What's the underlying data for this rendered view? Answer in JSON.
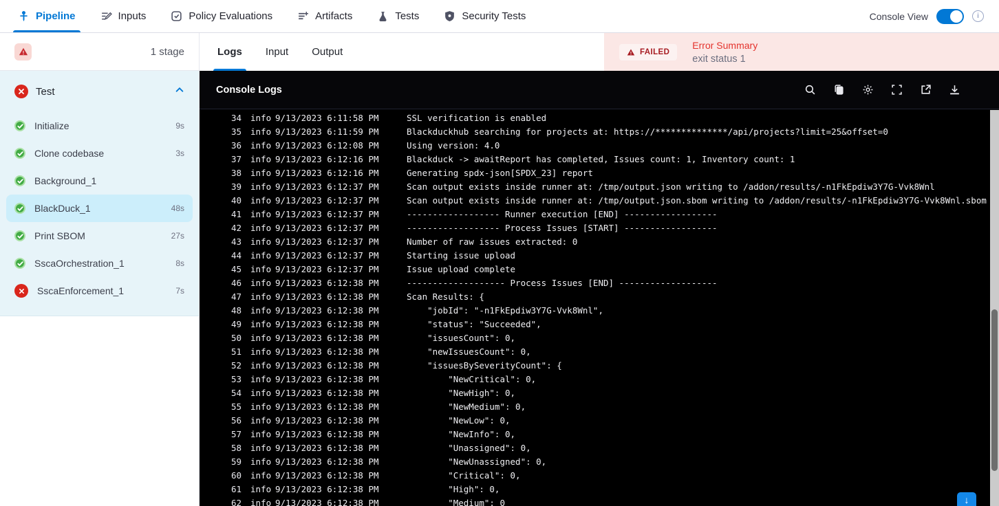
{
  "nav": {
    "tabs": [
      {
        "label": "Pipeline",
        "icon": "pipeline-icon",
        "active": true
      },
      {
        "label": "Inputs",
        "icon": "inputs-icon",
        "active": false
      },
      {
        "label": "Policy Evaluations",
        "icon": "policy-check-icon",
        "active": false
      },
      {
        "label": "Artifacts",
        "icon": "list-plus-icon",
        "active": false
      },
      {
        "label": "Tests",
        "icon": "flask-icon",
        "active": false
      },
      {
        "label": "Security Tests",
        "icon": "shield-icon",
        "active": false
      }
    ],
    "console_view_label": "Console View",
    "console_view_toggle": "on"
  },
  "sidebar": {
    "stage_count": "1 stage",
    "stage": {
      "name": "Test",
      "status": "failed"
    },
    "steps": [
      {
        "name": "Initialize",
        "duration": "9s",
        "status": "success",
        "selected": false
      },
      {
        "name": "Clone codebase",
        "duration": "3s",
        "status": "success",
        "selected": false
      },
      {
        "name": "Background_1",
        "duration": "",
        "status": "success",
        "selected": false
      },
      {
        "name": "BlackDuck_1",
        "duration": "48s",
        "status": "success",
        "selected": true
      },
      {
        "name": "Print SBOM",
        "duration": "27s",
        "status": "success",
        "selected": false
      },
      {
        "name": "SscaOrchestration_1",
        "duration": "8s",
        "status": "success",
        "selected": false
      },
      {
        "name": "SscaEnforcement_1",
        "duration": "7s",
        "status": "failed",
        "selected": false
      }
    ]
  },
  "main": {
    "tabs": [
      "Logs",
      "Input",
      "Output"
    ],
    "active_tab": "Logs",
    "error_summary": {
      "badge": "FAILED",
      "title": "Error Summary",
      "message": "exit status 1"
    }
  },
  "console": {
    "title": "Console Logs",
    "toolbar_icons": [
      "search-icon",
      "copy-icon",
      "settings-icon",
      "fullscreen-icon",
      "open-in-new-icon",
      "download-icon"
    ],
    "logs": [
      {
        "n": 34,
        "level": "info",
        "time": "9/13/2023 6:11:58 PM",
        "msg": "SSL verification is enabled"
      },
      {
        "n": 35,
        "level": "info",
        "time": "9/13/2023 6:11:59 PM",
        "msg": "Blackduckhub searching for projects at: https://**************/api/projects?limit=25&offset=0"
      },
      {
        "n": 36,
        "level": "info",
        "time": "9/13/2023 6:12:08 PM",
        "msg": "Using version: 4.0"
      },
      {
        "n": 37,
        "level": "info",
        "time": "9/13/2023 6:12:16 PM",
        "msg": "Blackduck -> awaitReport has completed, Issues count: 1, Inventory count: 1"
      },
      {
        "n": 38,
        "level": "info",
        "time": "9/13/2023 6:12:16 PM",
        "msg": "Generating spdx-json[SPDX_23] report"
      },
      {
        "n": 39,
        "level": "info",
        "time": "9/13/2023 6:12:37 PM",
        "msg": "Scan output exists inside runner at: /tmp/output.json writing to /addon/results/-n1FkEpdiw3Y7G-Vvk8Wnl"
      },
      {
        "n": 40,
        "level": "info",
        "time": "9/13/2023 6:12:37 PM",
        "msg": "Scan output exists inside runner at: /tmp/output.json.sbom writing to /addon/results/-n1FkEpdiw3Y7G-Vvk8Wnl.sbom"
      },
      {
        "n": 41,
        "level": "info",
        "time": "9/13/2023 6:12:37 PM",
        "msg": "------------------ Runner execution [END] ------------------"
      },
      {
        "n": 42,
        "level": "info",
        "time": "9/13/2023 6:12:37 PM",
        "msg": "------------------ Process Issues [START] ------------------"
      },
      {
        "n": 43,
        "level": "info",
        "time": "9/13/2023 6:12:37 PM",
        "msg": "Number of raw issues extracted: 0"
      },
      {
        "n": 44,
        "level": "info",
        "time": "9/13/2023 6:12:37 PM",
        "msg": "Starting issue upload"
      },
      {
        "n": 45,
        "level": "info",
        "time": "9/13/2023 6:12:37 PM",
        "msg": "Issue upload complete"
      },
      {
        "n": 46,
        "level": "info",
        "time": "9/13/2023 6:12:38 PM",
        "msg": "------------------- Process Issues [END] -------------------"
      },
      {
        "n": 47,
        "level": "info",
        "time": "9/13/2023 6:12:38 PM",
        "msg": "Scan Results: {"
      },
      {
        "n": 48,
        "level": "info",
        "time": "9/13/2023 6:12:38 PM",
        "msg": "    \"jobId\": \"-n1FkEpdiw3Y7G-Vvk8Wnl\","
      },
      {
        "n": 49,
        "level": "info",
        "time": "9/13/2023 6:12:38 PM",
        "msg": "    \"status\": \"Succeeded\","
      },
      {
        "n": 50,
        "level": "info",
        "time": "9/13/2023 6:12:38 PM",
        "msg": "    \"issuesCount\": 0,"
      },
      {
        "n": 51,
        "level": "info",
        "time": "9/13/2023 6:12:38 PM",
        "msg": "    \"newIssuesCount\": 0,"
      },
      {
        "n": 52,
        "level": "info",
        "time": "9/13/2023 6:12:38 PM",
        "msg": "    \"issuesBySeverityCount\": {"
      },
      {
        "n": 53,
        "level": "info",
        "time": "9/13/2023 6:12:38 PM",
        "msg": "        \"NewCritical\": 0,"
      },
      {
        "n": 54,
        "level": "info",
        "time": "9/13/2023 6:12:38 PM",
        "msg": "        \"NewHigh\": 0,"
      },
      {
        "n": 55,
        "level": "info",
        "time": "9/13/2023 6:12:38 PM",
        "msg": "        \"NewMedium\": 0,"
      },
      {
        "n": 56,
        "level": "info",
        "time": "9/13/2023 6:12:38 PM",
        "msg": "        \"NewLow\": 0,"
      },
      {
        "n": 57,
        "level": "info",
        "time": "9/13/2023 6:12:38 PM",
        "msg": "        \"NewInfo\": 0,"
      },
      {
        "n": 58,
        "level": "info",
        "time": "9/13/2023 6:12:38 PM",
        "msg": "        \"Unassigned\": 0,"
      },
      {
        "n": 59,
        "level": "info",
        "time": "9/13/2023 6:12:38 PM",
        "msg": "        \"NewUnassigned\": 0,"
      },
      {
        "n": 60,
        "level": "info",
        "time": "9/13/2023 6:12:38 PM",
        "msg": "        \"Critical\": 0,"
      },
      {
        "n": 61,
        "level": "info",
        "time": "9/13/2023 6:12:38 PM",
        "msg": "        \"High\": 0,"
      },
      {
        "n": 62,
        "level": "info",
        "time": "9/13/2023 6:12:38 PM",
        "msg": "        \"Medium\": 0"
      }
    ]
  },
  "colors": {
    "accent_blue": "#0278d5",
    "sidebar_blue": "#e7f4f9",
    "selected_step": "#cceefb",
    "success_green": "#42ab45",
    "fail_red": "#d9261c",
    "error_panel_pink": "#fbe7e5",
    "error_text_red": "#e4332d",
    "console_black": "#000000"
  }
}
